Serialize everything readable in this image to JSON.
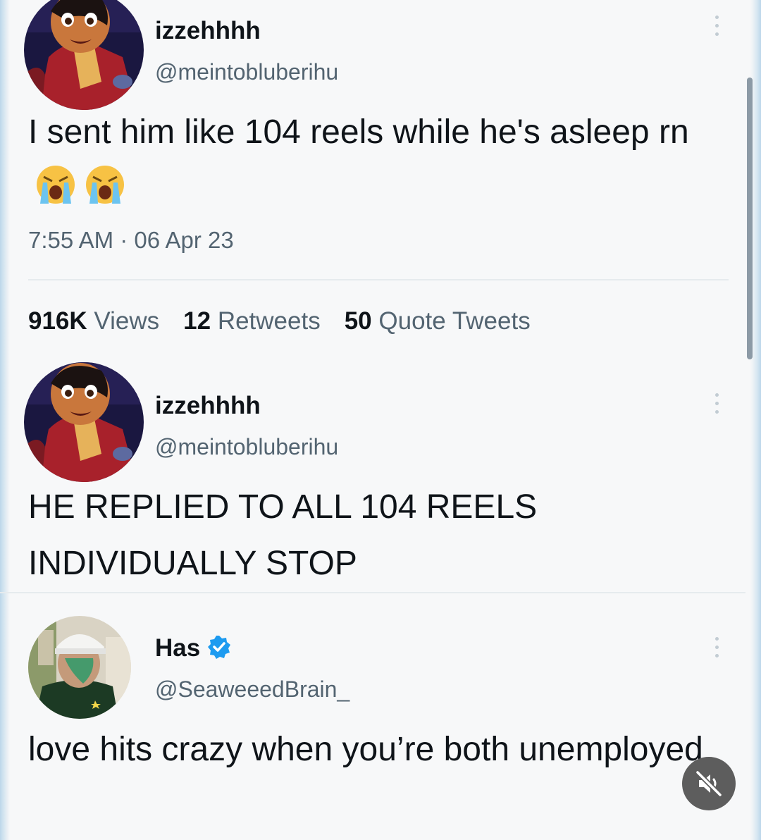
{
  "tweets": [
    {
      "name": "izzehhhh",
      "handle": "@meintobluberihu",
      "text": "I sent him like 104 reels while he's asleep rn",
      "emoji": [
        "loudly-crying-face",
        "loudly-crying-face"
      ],
      "time": "7:55 AM · 06 Apr 23",
      "stats": [
        {
          "value": "916K",
          "label": "Views"
        },
        {
          "value": "12",
          "label": "Retweets"
        },
        {
          "value": "50",
          "label": "Quote Tweets"
        }
      ]
    },
    {
      "name": "izzehhhh",
      "handle": "@meintobluberihu",
      "text": "HE REPLIED TO ALL 104 REELS INDIVIDUALLY STOP"
    },
    {
      "name": "Has",
      "verified": true,
      "handle": "@SeaweeedBrain_",
      "text": "love hits crazy when you’re both unemployed"
    }
  ],
  "controls": {
    "mute_icon": "speaker-muted-icon"
  },
  "colors": {
    "text": "#0f1419",
    "secondary": "#536471",
    "verified": "#1d9bf0"
  }
}
